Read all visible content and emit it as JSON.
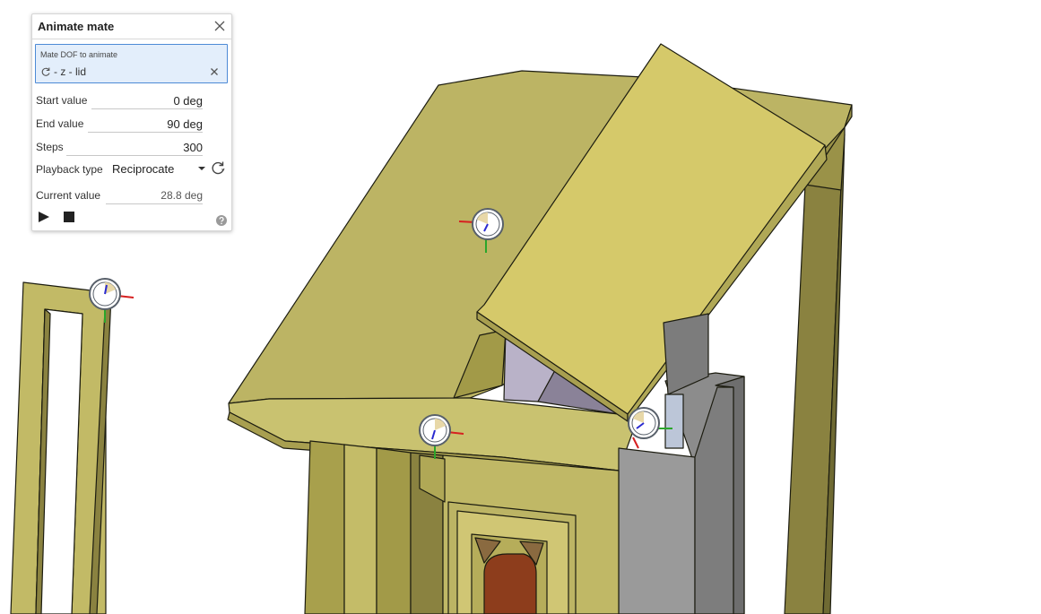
{
  "dialog": {
    "title": "Animate mate",
    "dof_label": "Mate DOF to animate",
    "dof_value": "- z - lid",
    "start_label": "Start value",
    "start_value": "0 deg",
    "end_label": "End value",
    "end_value": "90 deg",
    "steps_label": "Steps",
    "steps_value": "300",
    "playback_label": "Playback type",
    "playback_value": "Reciprocate",
    "current_label": "Current value",
    "current_value": "28.8 deg"
  },
  "icons": {
    "close": "close-icon",
    "dof": "rotate-dof-icon",
    "clear": "clear-icon",
    "caret": "chevron-down-icon",
    "reciprocate": "reciprocate-icon",
    "play": "play-icon",
    "stop": "stop-icon",
    "help": "help-icon",
    "mate_connector": "mate-connector-icon"
  },
  "colors": {
    "accent": "#4d8ad6",
    "dof_field_bg": "#e3eefb",
    "wood": "#bcb464",
    "lid": "#d5c96a",
    "dark_wood": "#8a8240",
    "metal": "#8a8a8a",
    "door_inlay": "#8d3d1c"
  }
}
